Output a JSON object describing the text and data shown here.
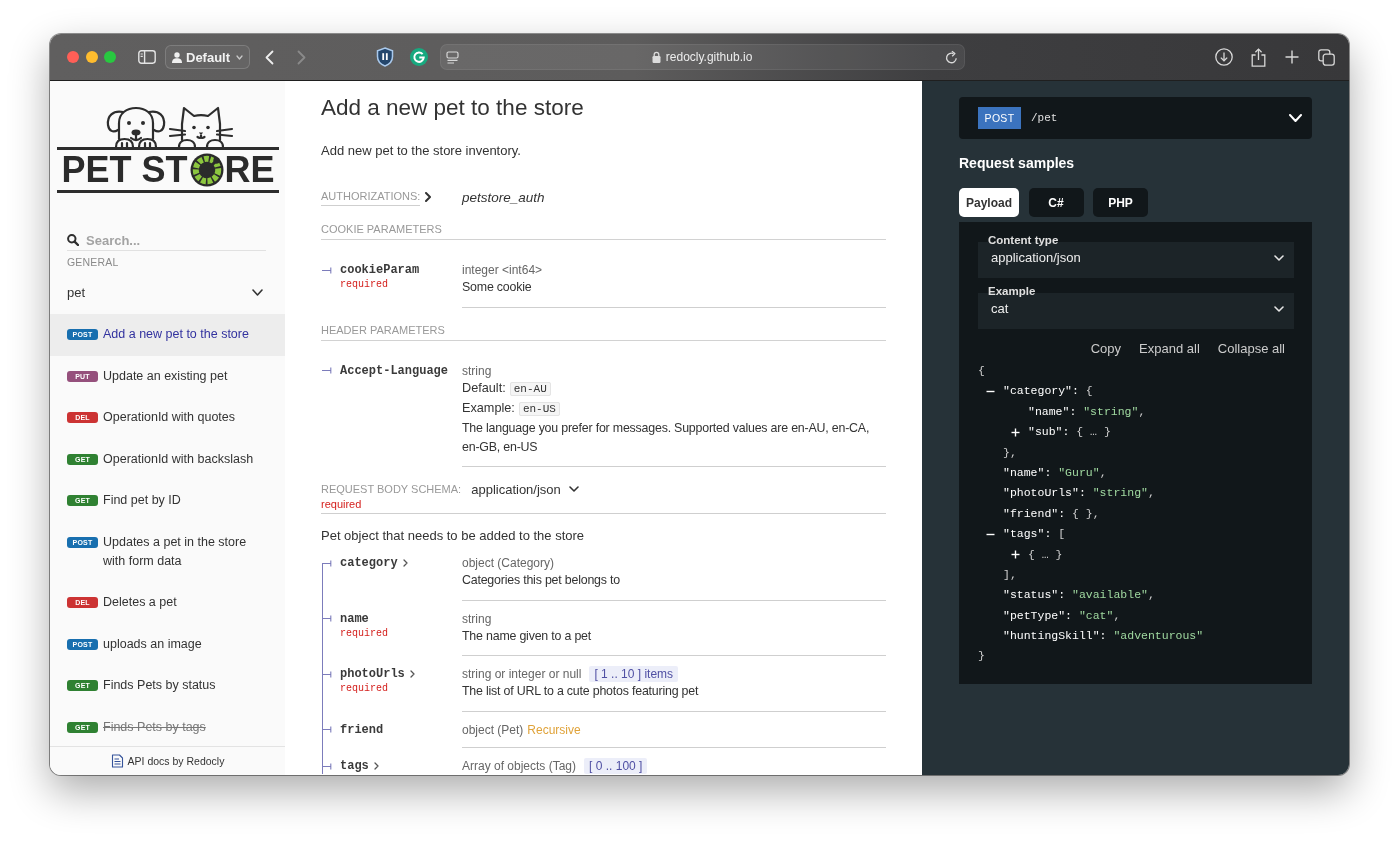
{
  "browser": {
    "profile": "Default",
    "url": "redocly.github.io",
    "back_disabled": false,
    "forward_disabled": true
  },
  "sidebar": {
    "logo": {
      "text_start": "PET ST",
      "text_end": "RE"
    },
    "search": {
      "placeholder": "Search..."
    },
    "section_label": "GENERAL",
    "group": {
      "label": "pet",
      "expanded": true,
      "items": [
        {
          "method": "POST",
          "color": "#186faf",
          "label": "Add a new pet to the store",
          "selected": true,
          "deprecated": false
        },
        {
          "method": "PUT",
          "color": "#95507c",
          "label": "Update an existing pet",
          "selected": false,
          "deprecated": false
        },
        {
          "method": "DEL",
          "color": "#cc3333",
          "label": "OperationId with quotes",
          "selected": false,
          "deprecated": false
        },
        {
          "method": "GET",
          "color": "#2f8132",
          "label": "OperationId with backslash",
          "selected": false,
          "deprecated": false
        },
        {
          "method": "GET",
          "color": "#2f8132",
          "label": "Find pet by ID",
          "selected": false,
          "deprecated": false
        },
        {
          "method": "POST",
          "color": "#186faf",
          "label": "Updates a pet in the store with form data",
          "selected": false,
          "deprecated": false
        },
        {
          "method": "DEL",
          "color": "#cc3333",
          "label": "Deletes a pet",
          "selected": false,
          "deprecated": false
        },
        {
          "method": "POST",
          "color": "#186faf",
          "label": "uploads an image",
          "selected": false,
          "deprecated": false
        },
        {
          "method": "GET",
          "color": "#2f8132",
          "label": "Finds Pets by status",
          "selected": false,
          "deprecated": false
        },
        {
          "method": "GET",
          "color": "#2f8132",
          "label": "Finds Pets by tags",
          "selected": false,
          "deprecated": true
        }
      ]
    },
    "footer_link": "API docs by Redocly"
  },
  "operation": {
    "title": "Add a new pet to the store",
    "description": "Add new pet to the store inventory.",
    "authorizations": {
      "label": "AUTHORIZATIONS:",
      "expanded": false,
      "scheme": "petstore_auth"
    },
    "parameter_groups": [
      {
        "title": "COOKIE PARAMETERS",
        "params": [
          {
            "name": "cookieParam",
            "required": "required",
            "type": "integer <int64>",
            "description": "Some cookie"
          }
        ]
      },
      {
        "title": "HEADER PARAMETERS",
        "params": [
          {
            "name": "Accept-Language",
            "type": "string",
            "default_label": "Default:",
            "default": "en-AU",
            "example_label": "Example:",
            "example": "en-US",
            "description": "The language you prefer for messages. Supported values are en-AU, en-CA, en-GB, en-US"
          }
        ]
      }
    ],
    "request_body": {
      "label": "REQUEST BODY SCHEMA:",
      "media_type": "application/json",
      "required": "required",
      "description": "Pet object that needs to be added to the store",
      "properties": [
        {
          "name": "category",
          "expandable": true,
          "type": "object (Category)",
          "description": "Categories this pet belongs to"
        },
        {
          "name": "name",
          "expandable": false,
          "required": "required",
          "type": "string",
          "description": "The name given to a pet"
        },
        {
          "name": "photoUrls",
          "expandable": true,
          "required": "required",
          "type": "string or integer or null",
          "constraint": "[ 1 .. 10 ] items",
          "description": "The list of URL to a cute photos featuring pet"
        },
        {
          "name": "friend",
          "expandable": false,
          "type": "object (Pet)",
          "recursive": "Recursive"
        },
        {
          "name": "tags",
          "expandable": true,
          "type": "Array of objects (Tag)",
          "constraint": "[ 0 .. 100 ]"
        }
      ]
    }
  },
  "samples": {
    "endpoint": {
      "method": "POST",
      "path": "/pet"
    },
    "title": "Request samples",
    "tabs": [
      {
        "label": "Payload",
        "selected": true
      },
      {
        "label": "C#",
        "selected": false
      },
      {
        "label": "PHP",
        "selected": false
      }
    ],
    "content_type": {
      "label": "Content type",
      "value": "application/json"
    },
    "example": {
      "label": "Example",
      "value": "cat"
    },
    "actions": [
      "Copy",
      "Expand all",
      "Collapse all"
    ],
    "code": {
      "open": "{",
      "close": "}",
      "children": [
        {
          "kind": "group",
          "expanded": true,
          "key": "\"category\":",
          "open": "{",
          "close": "},",
          "children": [
            {
              "kind": "pair",
              "key": "\"name\":",
              "value": "\"string\"",
              "string_value": true,
              "end": ","
            },
            {
              "kind": "group",
              "expanded": false,
              "key": "\"sub\":",
              "open": "{",
              "ellipsis": "…",
              "close": "}"
            }
          ]
        },
        {
          "kind": "pair",
          "key": "\"name\":",
          "value": "\"Guru\"",
          "string_value": true,
          "end": ","
        },
        {
          "kind": "pair",
          "key": "\"photoUrls\":",
          "value": "\"string\"",
          "string_value": true,
          "end": ","
        },
        {
          "kind": "pair",
          "key": "\"friend\":",
          "value": "{ }",
          "string_value": false,
          "end": ","
        },
        {
          "kind": "group",
          "expanded": true,
          "key": "\"tags\":",
          "open": "[",
          "close": "],",
          "children": [
            {
              "kind": "group",
              "expanded": false,
              "open": "{",
              "ellipsis": "…",
              "close": "}"
            }
          ]
        },
        {
          "kind": "pair",
          "key": "\"status\":",
          "value": "\"available\"",
          "string_value": true,
          "end": ","
        },
        {
          "kind": "pair",
          "key": "\"petType\":",
          "value": "\"cat\"",
          "string_value": true,
          "end": ","
        },
        {
          "kind": "pair",
          "key": "\"huntingSkill\":",
          "value": "\"adventurous\"",
          "string_value": true
        }
      ]
    }
  }
}
